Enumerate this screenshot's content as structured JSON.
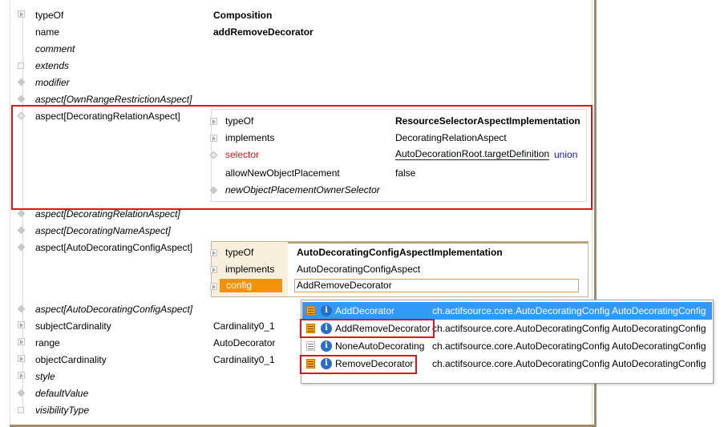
{
  "colors": {
    "frame": "#a08c68",
    "highlight_red": "#e0141e",
    "config_label_bg": "#f0920a",
    "selection_blue": "#3399ff",
    "link_blue": "#1a1aaa"
  },
  "properties": [
    {
      "label": "typeOf",
      "value": "Composition",
      "italic": false,
      "bold_value": true,
      "icon": "triangle-expand-icon"
    },
    {
      "label": "name",
      "value": "addRemoveDecorator",
      "italic": false,
      "bold_value": true,
      "icon": "none"
    },
    {
      "label": "comment",
      "value": "",
      "italic": true,
      "icon": "none"
    },
    {
      "label": "extends",
      "value": "",
      "italic": true,
      "icon": "box-icon"
    },
    {
      "label": "modifier",
      "value": "",
      "italic": true,
      "icon": "diamond-icon"
    },
    {
      "label": "aspect[OwnRangeRestrictionAspect]",
      "value": "",
      "italic": true,
      "icon": "diamond-icon"
    },
    {
      "label": "aspect[DecoratingRelationAspect]",
      "value": "",
      "italic": false,
      "icon": "diamond-icon"
    },
    {
      "label": "aspect[DecoratingRelationAspect]",
      "value": "",
      "italic": true,
      "icon": "diamond-icon"
    },
    {
      "label": "aspect[DecoratingNameAspect]",
      "value": "",
      "italic": true,
      "icon": "diamond-icon"
    },
    {
      "label": "aspect[AutoDecoratingConfigAspect]",
      "value": "",
      "italic": false,
      "icon": "diamond-icon"
    },
    {
      "label": "aspect[AutoDecoratingConfigAspect]",
      "value": "",
      "italic": true,
      "icon": "diamond-icon"
    },
    {
      "label": "subjectCardinality",
      "value": "Cardinality0_1",
      "italic": false,
      "icon": "triangle-expand-icon"
    },
    {
      "label": "range",
      "value": "AutoDecorator",
      "italic": false,
      "icon": "triangle-expand-icon"
    },
    {
      "label": "objectCardinality",
      "value": "Cardinality0_1",
      "italic": false,
      "icon": "triangle-expand-icon"
    },
    {
      "label": "style",
      "value": "",
      "italic": true,
      "icon": "triangle-expand-icon"
    },
    {
      "label": "defaultValue",
      "value": "",
      "italic": true,
      "icon": "diamond-icon"
    },
    {
      "label": "visibilityType",
      "value": "",
      "italic": true,
      "icon": "box-icon"
    }
  ],
  "decorating_panel": {
    "rows": [
      {
        "label": "typeOf",
        "value": "ResourceSelectorAspectImplementation",
        "bold_value": true
      },
      {
        "label": "implements",
        "value": "DecoratingRelationAspect"
      },
      {
        "label": "selector",
        "value": "AutoDecorationRoot.targetDefinition",
        "suffix": "union",
        "label_red": true
      },
      {
        "label": "allowNewObjectPlacement",
        "value": "false"
      },
      {
        "label": "newObjectPlacementOwnerSelector",
        "value": "",
        "italic": true
      }
    ]
  },
  "config_panel": {
    "rows": [
      {
        "label": "typeOf",
        "value": "AutoDecoratingConfigAspectImplementation",
        "bold_value": true
      },
      {
        "label": "implements",
        "value": "AutoDecoratingConfigAspect"
      },
      {
        "label": "config",
        "value": "AddRemoveDecorator"
      }
    ]
  },
  "dropdown": {
    "items": [
      {
        "name": "AddDecorator",
        "path": "ch.actifsource.core.AutoDecoratingConfig AutoDecoratingConfig",
        "selected": true,
        "highlighted": false
      },
      {
        "name": "AddRemoveDecorator",
        "path": "ch.actifsource.core.AutoDecoratingConfig AutoDecoratingConfig",
        "selected": false,
        "highlighted": true
      },
      {
        "name": "NoneAutoDecorating",
        "path": "ch.actifsource.core.AutoDecoratingConfig AutoDecoratingConfig",
        "selected": false,
        "highlighted": false
      },
      {
        "name": "RemoveDecorator",
        "path": "ch.actifsource.core.AutoDecoratingConfig AutoDecoratingConfig",
        "selected": false,
        "highlighted": true
      }
    ]
  }
}
